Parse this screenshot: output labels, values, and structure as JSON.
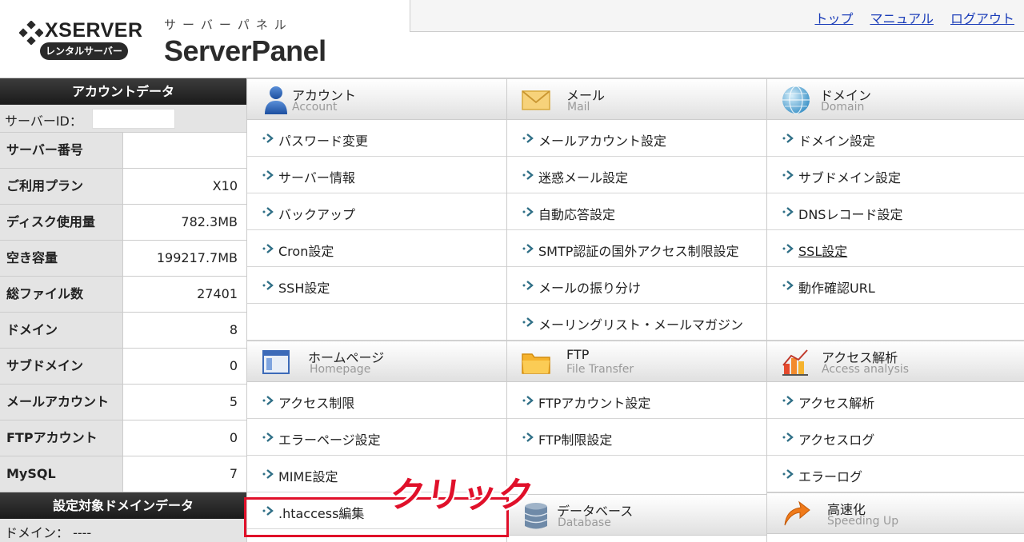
{
  "header": {
    "brand": "XSERVER",
    "brand_sub": "レンタルサーバー",
    "product_kana": "サーバーパネル",
    "product_name": "ServerPanel",
    "links": [
      "トップ",
      "マニュアル",
      "ログアウト"
    ]
  },
  "sidebar": {
    "account_title": "アカウントデータ",
    "server_id_label": "サーバーID：",
    "stats": [
      {
        "key": "サーバー番号",
        "value": ""
      },
      {
        "key": "ご利用プラン",
        "value": "X10"
      },
      {
        "key": "ディスク使用量",
        "value": "782.3MB"
      },
      {
        "key": "空き容量",
        "value": "199217.7MB"
      },
      {
        "key": "総ファイル数",
        "value": "27401"
      },
      {
        "key": "ドメイン",
        "value": "8"
      },
      {
        "key": "サブドメイン",
        "value": "0"
      },
      {
        "key": "メールアカウント",
        "value": "5"
      },
      {
        "key": "FTPアカウント",
        "value": "0"
      },
      {
        "key": "MySQL",
        "value": "7"
      }
    ],
    "domain_title": "設定対象ドメインデータ",
    "domain_label": "ドメイン：",
    "domain_value": "----"
  },
  "sections": {
    "account": {
      "ja": "アカウント",
      "en": "Account",
      "items": [
        "パスワード変更",
        "サーバー情報",
        "バックアップ",
        "Cron設定",
        "SSH設定"
      ]
    },
    "mail": {
      "ja": "メール",
      "en": "Mail",
      "items": [
        "メールアカウント設定",
        "迷惑メール設定",
        "自動応答設定",
        "SMTP認証の国外アクセス制限設定",
        "メールの振り分け",
        "メーリングリスト・メールマガジン"
      ]
    },
    "domain": {
      "ja": "ドメイン",
      "en": "Domain",
      "items": [
        "ドメイン設定",
        "サブドメイン設定",
        "DNSレコード設定",
        "SSL設定",
        "動作確認URL"
      ]
    },
    "homepage": {
      "ja": "ホームページ",
      "en": "Homepage",
      "items": [
        "アクセス制限",
        "エラーページ設定",
        "MIME設定",
        ".htaccess編集"
      ]
    },
    "ftp": {
      "ja": "FTP",
      "en": "File Transfer",
      "items": [
        "FTPアカウント設定",
        "FTP制限設定"
      ]
    },
    "access": {
      "ja": "アクセス解析",
      "en": "Access analysis",
      "items": [
        "アクセス解析",
        "アクセスログ",
        "エラーログ"
      ]
    },
    "database": {
      "ja": "データベース",
      "en": "Database"
    },
    "speed": {
      "ja": "高速化",
      "en": "Speeding Up"
    }
  },
  "annotation": {
    "label": "クリック"
  },
  "colors": {
    "accent": "#e0102a",
    "link": "#1a3cb8",
    "arrow": "#2f6f86"
  }
}
